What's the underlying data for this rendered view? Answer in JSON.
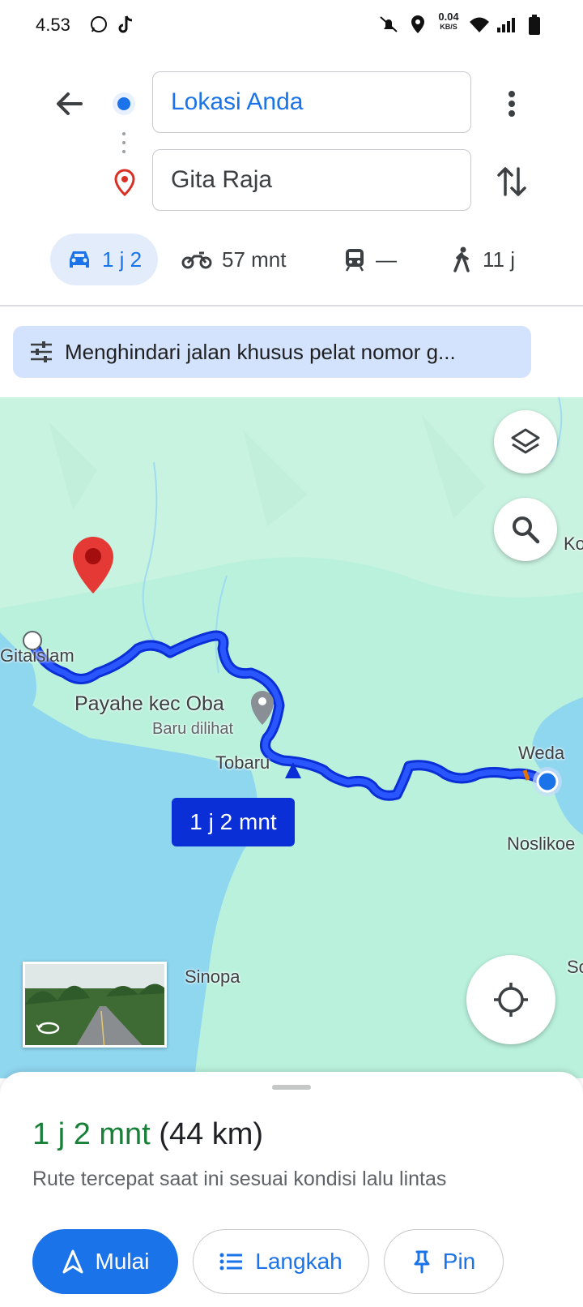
{
  "status_bar": {
    "time": "4.53",
    "net_speed": "0.04",
    "net_unit": "KB/S"
  },
  "directions": {
    "origin": "Lokasi Anda",
    "destination": "Gita Raja"
  },
  "modes": [
    {
      "name": "car",
      "label": "1 j 2",
      "active": true
    },
    {
      "name": "motorcycle",
      "label": "57 mnt",
      "active": false
    },
    {
      "name": "transit",
      "label": "—",
      "active": false
    },
    {
      "name": "walk",
      "label": "11 j",
      "active": false
    }
  ],
  "options_chip": "Menghindari jalan khusus pelat nomor g...",
  "map": {
    "labels": {
      "gitaislam": "Gitaislam",
      "payahe": "Payahe kec Oba",
      "baru": "Baru dilihat",
      "tobaru": "Tobaru",
      "weda": "Weda",
      "noslikoe": "Noslikoe",
      "sinopa": "Sinopa",
      "ko": "Ko",
      "so": "So"
    },
    "route_duration": "1 j 2 mnt"
  },
  "sheet": {
    "duration": "1 j 2 mnt",
    "distance": "(44 km)",
    "subtitle": "Rute tercepat saat ini sesuai kondisi lalu lintas",
    "buttons": {
      "start": "Mulai",
      "steps": "Langkah",
      "pin": "Pin"
    }
  },
  "colors": {
    "accent": "#1a73e8",
    "route": "#1a3ff0",
    "land": "#b9f1dc",
    "water": "#8fd6ef",
    "duration_green": "#188038",
    "pin_red": "#e53935"
  }
}
